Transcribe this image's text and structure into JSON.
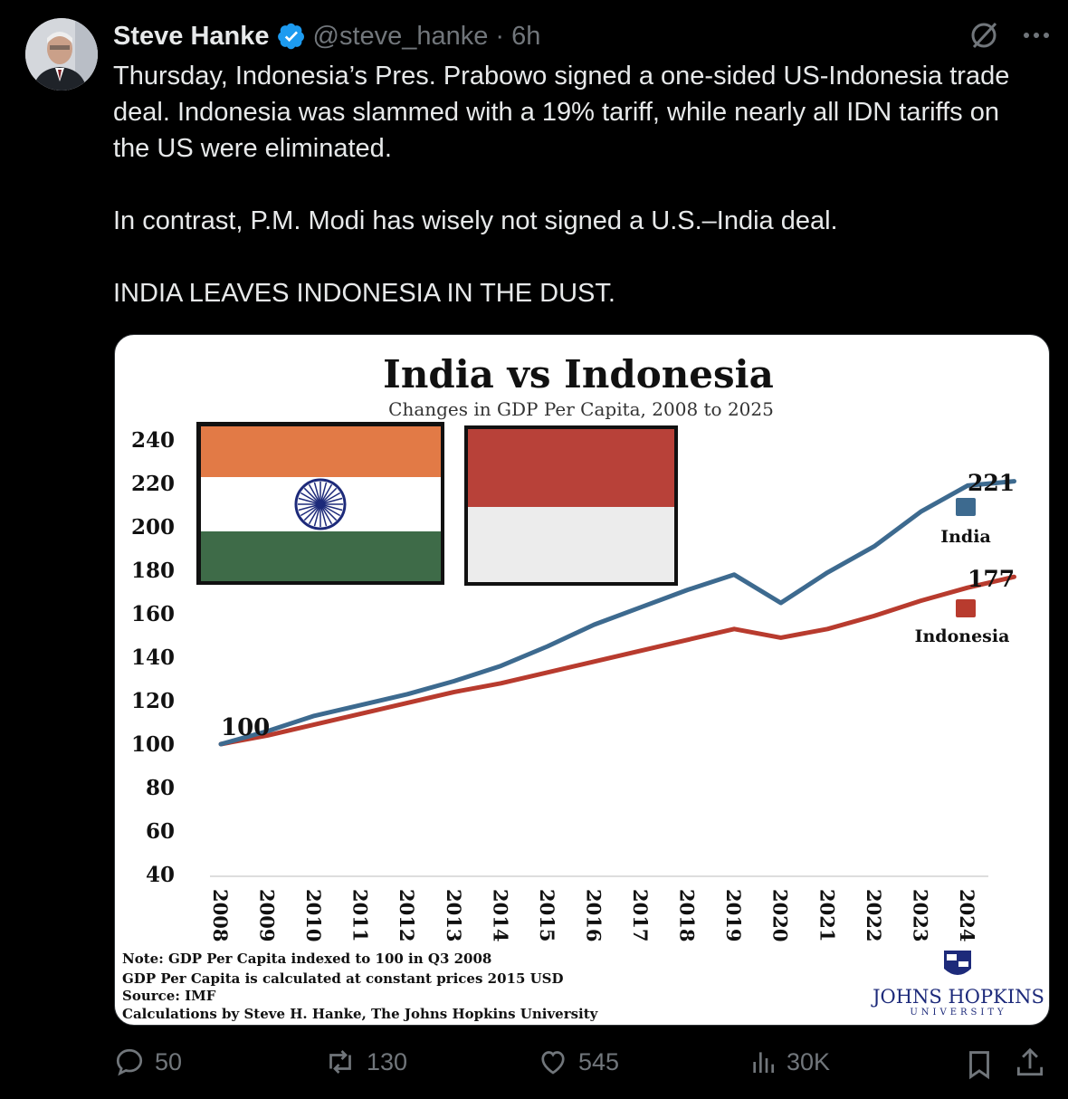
{
  "tweet": {
    "author_name": "Steve Hanke",
    "handle": "@steve_hanke",
    "time": "· 6h",
    "paragraphs": [
      "Thursday, Indonesia’s Pres. Prabowo signed a one-sided US-Indonesia trade deal. Indonesia was slammed with a 19% tariff, while nearly all IDN tariffs on the US were eliminated.",
      "In contrast, P.M. Modi has wisely not signed a U.S.–India deal.",
      "INDIA LEAVES INDONESIA IN THE DUST."
    ]
  },
  "actions": {
    "replies": "50",
    "reposts": "130",
    "likes": "545",
    "views": "30K"
  },
  "icons": {
    "verified": "verified-badge-icon",
    "grok": "grok-icon",
    "more": "more-icon",
    "reply": "reply-icon",
    "repost": "repost-icon",
    "like": "heart-icon",
    "views": "views-icon",
    "bookmark": "bookmark-icon",
    "share": "share-icon"
  },
  "colors": {
    "india": "#3d6a8f",
    "indonesia": "#b83b2e",
    "accent_blue": "#1d9bf0",
    "muted": "#71767b"
  },
  "chart_data": {
    "type": "line",
    "title": "India vs Indonesia",
    "subtitle": "Changes in GDP Per Capita, 2008 to 2025",
    "x": [
      "2008",
      "2009",
      "2010",
      "2011",
      "2012",
      "2013",
      "2014",
      "2015",
      "2016",
      "2017",
      "2018",
      "2019",
      "2020",
      "2021",
      "2022",
      "2023",
      "2024"
    ],
    "yticks": [
      40,
      60,
      80,
      100,
      120,
      140,
      160,
      180,
      200,
      220,
      240
    ],
    "ylim": [
      40,
      240
    ],
    "series": [
      {
        "name": "India",
        "color": "#3d6a8f",
        "x": [
          "2008",
          "2009",
          "2010",
          "2011",
          "2012",
          "2013",
          "2014",
          "2015",
          "2016",
          "2017",
          "2018",
          "2019",
          "2020",
          "2021",
          "2022",
          "2023",
          "2024",
          "2025"
        ],
        "values": [
          100,
          106,
          113,
          118,
          123,
          129,
          136,
          145,
          155,
          163,
          171,
          178,
          165,
          179,
          191,
          207,
          219,
          221
        ]
      },
      {
        "name": "Indonesia",
        "color": "#b83b2e",
        "x": [
          "2008",
          "2009",
          "2010",
          "2011",
          "2012",
          "2013",
          "2014",
          "2015",
          "2016",
          "2017",
          "2018",
          "2019",
          "2020",
          "2021",
          "2022",
          "2023",
          "2024",
          "2025"
        ],
        "values": [
          100,
          104,
          109,
          114,
          119,
          124,
          128,
          133,
          138,
          143,
          148,
          153,
          149,
          153,
          159,
          166,
          172,
          177
        ]
      }
    ],
    "annotations": {
      "start": "100",
      "india_end": "221",
      "indonesia_end": "177"
    },
    "legend": "right",
    "notes": [
      "Note: GDP Per Capita indexed to 100 in Q3 2008",
      "GDP Per Capita is calculated at constant prices 2015 USD",
      "Source: IMF",
      "Calculations by Steve H. Hanke, The Johns Hopkins University"
    ],
    "logo_text": [
      "JOHNS HOPKINS",
      "UNIVERSITY"
    ]
  }
}
